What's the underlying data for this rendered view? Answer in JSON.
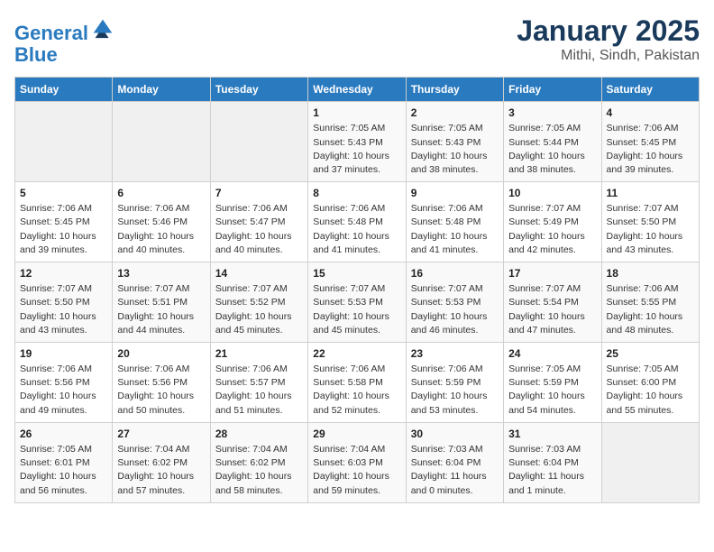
{
  "header": {
    "logo_line1": "General",
    "logo_line2": "Blue",
    "title": "January 2025",
    "subtitle": "Mithi, Sindh, Pakistan"
  },
  "weekdays": [
    "Sunday",
    "Monday",
    "Tuesday",
    "Wednesday",
    "Thursday",
    "Friday",
    "Saturday"
  ],
  "weeks": [
    [
      {
        "day": "",
        "info": ""
      },
      {
        "day": "",
        "info": ""
      },
      {
        "day": "",
        "info": ""
      },
      {
        "day": "1",
        "info": "Sunrise: 7:05 AM\nSunset: 5:43 PM\nDaylight: 10 hours\nand 37 minutes."
      },
      {
        "day": "2",
        "info": "Sunrise: 7:05 AM\nSunset: 5:43 PM\nDaylight: 10 hours\nand 38 minutes."
      },
      {
        "day": "3",
        "info": "Sunrise: 7:05 AM\nSunset: 5:44 PM\nDaylight: 10 hours\nand 38 minutes."
      },
      {
        "day": "4",
        "info": "Sunrise: 7:06 AM\nSunset: 5:45 PM\nDaylight: 10 hours\nand 39 minutes."
      }
    ],
    [
      {
        "day": "5",
        "info": "Sunrise: 7:06 AM\nSunset: 5:45 PM\nDaylight: 10 hours\nand 39 minutes."
      },
      {
        "day": "6",
        "info": "Sunrise: 7:06 AM\nSunset: 5:46 PM\nDaylight: 10 hours\nand 40 minutes."
      },
      {
        "day": "7",
        "info": "Sunrise: 7:06 AM\nSunset: 5:47 PM\nDaylight: 10 hours\nand 40 minutes."
      },
      {
        "day": "8",
        "info": "Sunrise: 7:06 AM\nSunset: 5:48 PM\nDaylight: 10 hours\nand 41 minutes."
      },
      {
        "day": "9",
        "info": "Sunrise: 7:06 AM\nSunset: 5:48 PM\nDaylight: 10 hours\nand 41 minutes."
      },
      {
        "day": "10",
        "info": "Sunrise: 7:07 AM\nSunset: 5:49 PM\nDaylight: 10 hours\nand 42 minutes."
      },
      {
        "day": "11",
        "info": "Sunrise: 7:07 AM\nSunset: 5:50 PM\nDaylight: 10 hours\nand 43 minutes."
      }
    ],
    [
      {
        "day": "12",
        "info": "Sunrise: 7:07 AM\nSunset: 5:50 PM\nDaylight: 10 hours\nand 43 minutes."
      },
      {
        "day": "13",
        "info": "Sunrise: 7:07 AM\nSunset: 5:51 PM\nDaylight: 10 hours\nand 44 minutes."
      },
      {
        "day": "14",
        "info": "Sunrise: 7:07 AM\nSunset: 5:52 PM\nDaylight: 10 hours\nand 45 minutes."
      },
      {
        "day": "15",
        "info": "Sunrise: 7:07 AM\nSunset: 5:53 PM\nDaylight: 10 hours\nand 45 minutes."
      },
      {
        "day": "16",
        "info": "Sunrise: 7:07 AM\nSunset: 5:53 PM\nDaylight: 10 hours\nand 46 minutes."
      },
      {
        "day": "17",
        "info": "Sunrise: 7:07 AM\nSunset: 5:54 PM\nDaylight: 10 hours\nand 47 minutes."
      },
      {
        "day": "18",
        "info": "Sunrise: 7:06 AM\nSunset: 5:55 PM\nDaylight: 10 hours\nand 48 minutes."
      }
    ],
    [
      {
        "day": "19",
        "info": "Sunrise: 7:06 AM\nSunset: 5:56 PM\nDaylight: 10 hours\nand 49 minutes."
      },
      {
        "day": "20",
        "info": "Sunrise: 7:06 AM\nSunset: 5:56 PM\nDaylight: 10 hours\nand 50 minutes."
      },
      {
        "day": "21",
        "info": "Sunrise: 7:06 AM\nSunset: 5:57 PM\nDaylight: 10 hours\nand 51 minutes."
      },
      {
        "day": "22",
        "info": "Sunrise: 7:06 AM\nSunset: 5:58 PM\nDaylight: 10 hours\nand 52 minutes."
      },
      {
        "day": "23",
        "info": "Sunrise: 7:06 AM\nSunset: 5:59 PM\nDaylight: 10 hours\nand 53 minutes."
      },
      {
        "day": "24",
        "info": "Sunrise: 7:05 AM\nSunset: 5:59 PM\nDaylight: 10 hours\nand 54 minutes."
      },
      {
        "day": "25",
        "info": "Sunrise: 7:05 AM\nSunset: 6:00 PM\nDaylight: 10 hours\nand 55 minutes."
      }
    ],
    [
      {
        "day": "26",
        "info": "Sunrise: 7:05 AM\nSunset: 6:01 PM\nDaylight: 10 hours\nand 56 minutes."
      },
      {
        "day": "27",
        "info": "Sunrise: 7:04 AM\nSunset: 6:02 PM\nDaylight: 10 hours\nand 57 minutes."
      },
      {
        "day": "28",
        "info": "Sunrise: 7:04 AM\nSunset: 6:02 PM\nDaylight: 10 hours\nand 58 minutes."
      },
      {
        "day": "29",
        "info": "Sunrise: 7:04 AM\nSunset: 6:03 PM\nDaylight: 10 hours\nand 59 minutes."
      },
      {
        "day": "30",
        "info": "Sunrise: 7:03 AM\nSunset: 6:04 PM\nDaylight: 11 hours\nand 0 minutes."
      },
      {
        "day": "31",
        "info": "Sunrise: 7:03 AM\nSunset: 6:04 PM\nDaylight: 11 hours\nand 1 minute."
      },
      {
        "day": "",
        "info": ""
      }
    ]
  ]
}
